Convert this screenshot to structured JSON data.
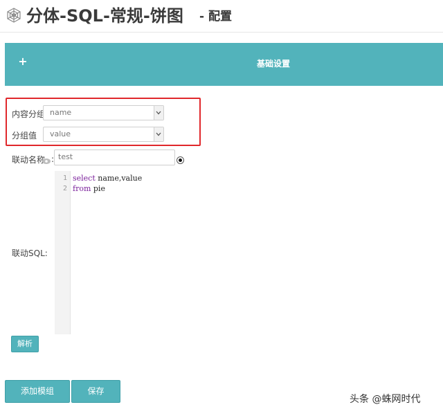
{
  "header": {
    "logo_icon": "spider-web-icon",
    "title": "分体-SQL-常规-饼图",
    "subtitle": "- 配置"
  },
  "section": {
    "expand_icon": "+",
    "title": "基础设置",
    "bar_color": "#52b3bb"
  },
  "form": {
    "content_group": {
      "label": "内容分组",
      "value": "name"
    },
    "group_value": {
      "label": "分组值",
      "value": "value"
    },
    "link_name": {
      "label": "联动名称",
      "help_icon": "eye-icon",
      "colon": ":",
      "value": "test"
    },
    "link_sql": {
      "label": "联动SQL:",
      "lines": [
        {
          "num": "1",
          "keyword": "select",
          "rest": " name,value"
        },
        {
          "num": "2",
          "keyword": "from",
          "rest": " pie"
        }
      ]
    },
    "parse_button": "解析"
  },
  "actions": {
    "add_group": "添加模组",
    "save": "保存"
  },
  "watermark": "头条 @蛛网时代",
  "colors": {
    "accent": "#52b3bb",
    "highlight": "#e0272b",
    "keyword": "#7a1f9a"
  }
}
